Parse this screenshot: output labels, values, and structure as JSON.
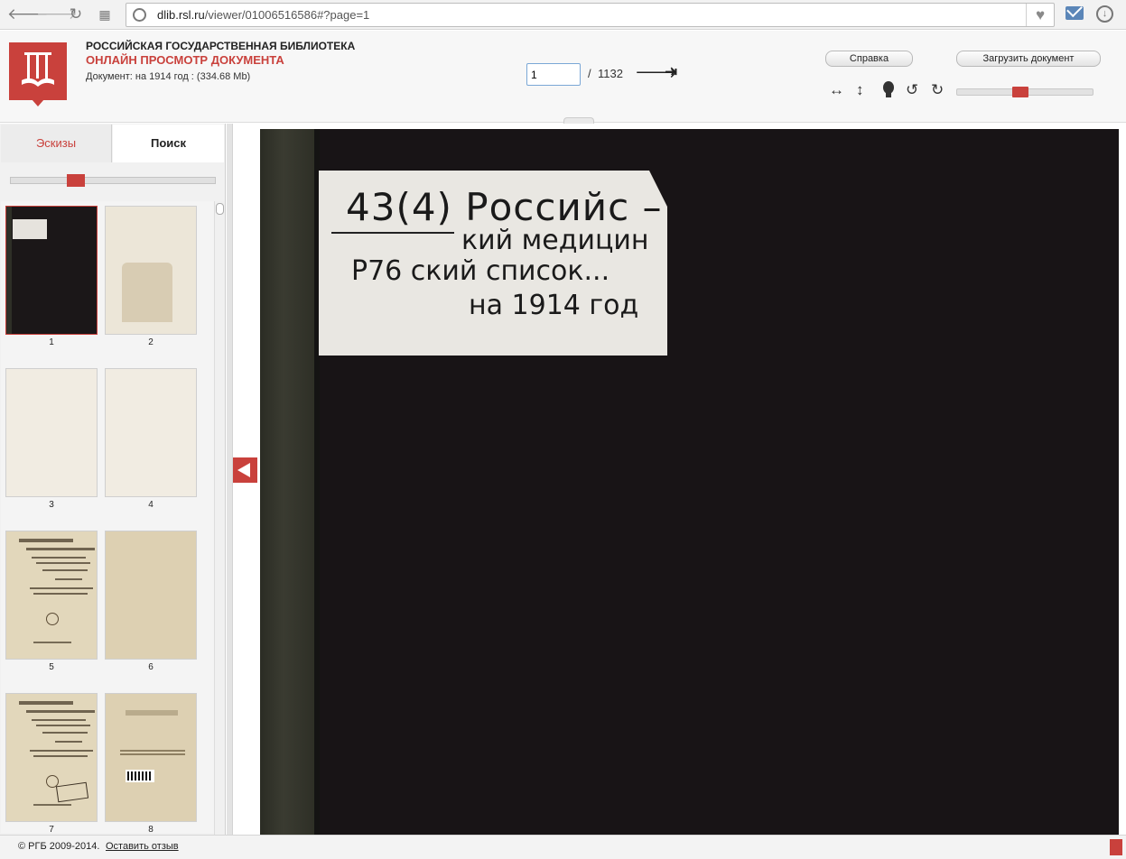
{
  "browser": {
    "url_host": "dlib.rsl.ru",
    "url_path": "/viewer/01006516586#?page=1"
  },
  "header": {
    "library_name": "РОССИЙСКАЯ ГОСУДАРСТВЕННАЯ БИБЛИОТЕКА",
    "viewer_name": "ОНЛАЙН ПРОСМОТР ДОКУМЕНТА",
    "document_info": "Документ: на 1914 год : (334.68 Mb)",
    "help_label": "Справка",
    "upload_label": "Загрузить документ"
  },
  "pager": {
    "current_page": "1",
    "separator": "/",
    "total_pages": "1132"
  },
  "zoom": {
    "level_fraction": 0.46
  },
  "thumb_size": {
    "level_fraction": 0.3
  },
  "sidebar": {
    "tabs": [
      {
        "label": "Эскизы",
        "active": true
      },
      {
        "label": "Поиск",
        "active": false
      }
    ],
    "thumbnails": [
      {
        "page": "1",
        "style": "dark-cover",
        "selected": true
      },
      {
        "page": "2",
        "style": "blank-with-pocket"
      },
      {
        "page": "3",
        "style": "blank"
      },
      {
        "page": "4",
        "style": "blank"
      },
      {
        "page": "5",
        "style": "title-page"
      },
      {
        "page": "6",
        "style": "aged-blank"
      },
      {
        "page": "7",
        "style": "title-page-stamped"
      },
      {
        "page": "8",
        "style": "back-with-barcode"
      }
    ]
  },
  "document_page": {
    "label_lines": [
      {
        "text": "43(4) Российс –"
      },
      {
        "text": "кий медицин"
      },
      {
        "text": "Р76 ский список..."
      },
      {
        "text": "на 1914 год"
      }
    ]
  },
  "footer": {
    "copyright": "© РГБ 2009-2014.",
    "feedback_link": "Оставить отзыв"
  },
  "colors": {
    "accent": "#c9413c",
    "cover": "#181416"
  }
}
